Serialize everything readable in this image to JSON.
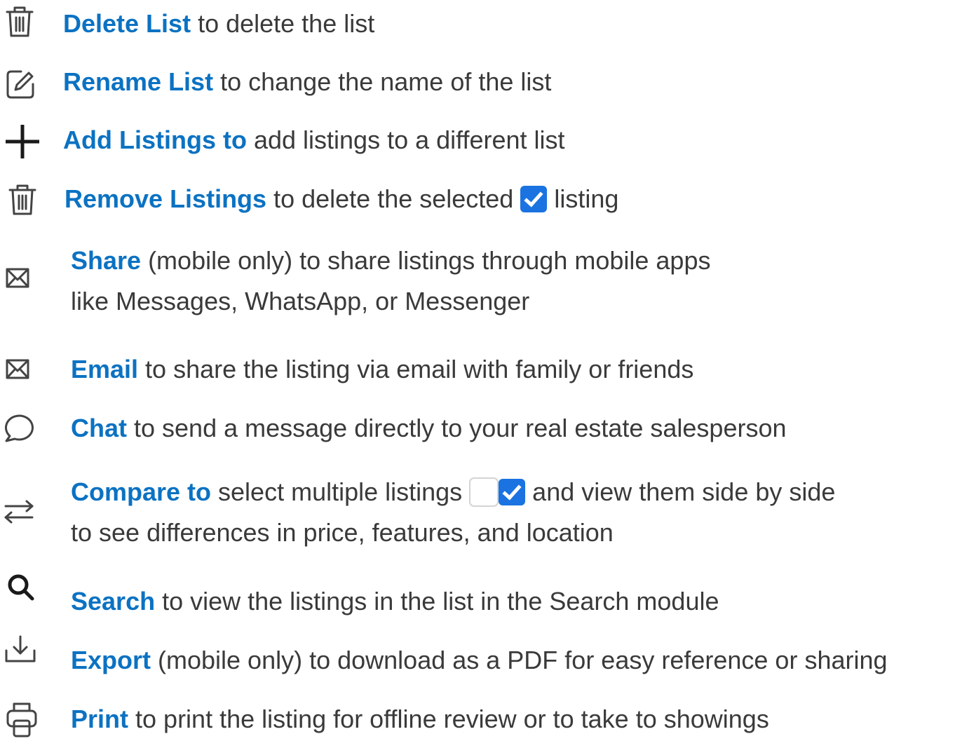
{
  "items": [
    {
      "icon": "trash-icon",
      "keyword": "Delete List",
      "text": " to delete the list"
    },
    {
      "icon": "edit-icon",
      "keyword": "Rename List",
      "text": " to change the name of the list"
    },
    {
      "icon": "plus-icon",
      "keyword": "Add Listings to",
      "text": " add listings to a different list"
    },
    {
      "icon": "trash-icon",
      "keyword": "Remove Listings",
      "text_before": " to delete the selected ",
      "text_after": " listing"
    },
    {
      "icon": "envelope-icon",
      "keyword": "Share",
      "text": " (mobile only) to share listings through mobile apps",
      "line2": "like Messages, WhatsApp, or Messenger"
    },
    {
      "icon": "envelope-icon",
      "keyword": "Email",
      "text": " to share the listing via email with family or friends"
    },
    {
      "icon": "chat-bubble-icon",
      "keyword": "Chat",
      "text": " to send a message directly to your real estate salesperson"
    },
    {
      "icon": "compare-arrows-icon",
      "keyword": "Compare to",
      "text_before": " select multiple listings ",
      "text_after": " and view them side by side",
      "line2": "to see differences in price, features, and location"
    },
    {
      "icon": "search-icon",
      "keyword": "Search",
      "text": " to view the listings in the list in the Search module"
    },
    {
      "icon": "download-icon",
      "keyword": "Export",
      "text": " (mobile only) to download as a PDF for easy reference or sharing"
    },
    {
      "icon": "printer-icon",
      "keyword": "Print",
      "text": " to print the listing for offline review or to take to showings"
    }
  ],
  "colors": {
    "keyword": "#0b72c2",
    "body_text": "#3a3a3a",
    "checkbox_checked": "#1a73e0",
    "icon": "#444444"
  }
}
